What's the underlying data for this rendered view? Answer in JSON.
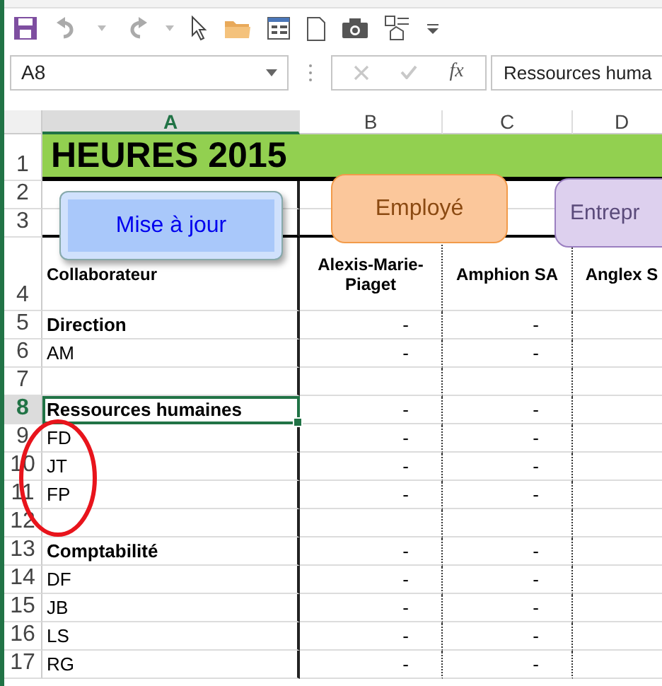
{
  "name_box": {
    "value": "A8"
  },
  "formula_bar": {
    "function_label": "fx",
    "value": "Ressources huma"
  },
  "columns": [
    {
      "label": "A",
      "selected": true
    },
    {
      "label": "B",
      "selected": false
    },
    {
      "label": "C",
      "selected": false
    },
    {
      "label": "D",
      "selected": false
    }
  ],
  "title_row": {
    "number": "1",
    "selected": false,
    "title": "HEURES 2015"
  },
  "spacer_rows": [
    {
      "number": "2",
      "selected": false
    },
    {
      "number": "3",
      "selected": false
    }
  ],
  "header_row": {
    "number": "4",
    "selected": false,
    "cells": [
      "Collaborateur",
      "Alexis-Marie-Piaget",
      "Amphion SA",
      "Anglex S"
    ]
  },
  "rows": [
    {
      "number": "5",
      "selected": false,
      "bold": true,
      "name": "Direction",
      "b": "-",
      "c": "-"
    },
    {
      "number": "6",
      "selected": false,
      "bold": false,
      "name": "AM",
      "b": "-",
      "c": "-"
    },
    {
      "number": "7",
      "selected": false
    },
    {
      "number": "8",
      "selected": true,
      "bold": true,
      "name": "Ressources humaines",
      "b": "-",
      "c": "-"
    },
    {
      "number": "9",
      "selected": false,
      "bold": false,
      "name": "FD",
      "b": "-",
      "c": "-"
    },
    {
      "number": "10",
      "selected": false,
      "bold": false,
      "name": "JT",
      "b": "-",
      "c": "-"
    },
    {
      "number": "11",
      "selected": false,
      "bold": false,
      "name": "FP",
      "b": "-",
      "c": "-"
    },
    {
      "number": "12",
      "selected": false
    },
    {
      "number": "13",
      "selected": false,
      "bold": true,
      "name": "Comptabilité",
      "b": "-",
      "c": "-"
    },
    {
      "number": "14",
      "selected": false,
      "bold": false,
      "name": "DF",
      "b": "-",
      "c": "-"
    },
    {
      "number": "15",
      "selected": false,
      "bold": false,
      "name": "JB",
      "b": "-",
      "c": "-"
    },
    {
      "number": "16",
      "selected": false,
      "bold": false,
      "name": "LS",
      "b": "-",
      "c": "-"
    },
    {
      "number": "17",
      "selected": false,
      "bold": false,
      "name": "RG",
      "b": "-",
      "c": "-"
    }
  ],
  "shapes": [
    {
      "label": "Mise à jour",
      "kind": "bevel",
      "color": "#a9c8fa"
    },
    {
      "label": "Employé",
      "kind": "rounded",
      "color": "#fbc79b"
    },
    {
      "label": "Entrepr",
      "kind": "rounded",
      "color": "#ddd0ee"
    }
  ]
}
